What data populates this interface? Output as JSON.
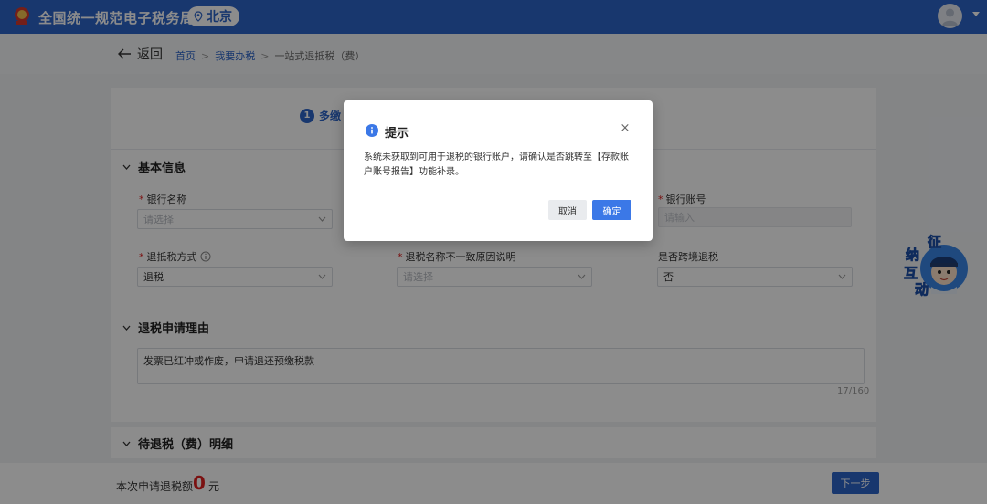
{
  "header": {
    "app_title": "全国统一规范电子税务局",
    "region": "北京",
    "brand_color": "#2c64c8"
  },
  "breadcrumb": {
    "back_label": "返回",
    "items": [
      "首页",
      "我要办税",
      "一站式退抵税（费）"
    ],
    "separator": ">"
  },
  "steps": {
    "current_number": "1",
    "current_label": "多缴"
  },
  "basic_info": {
    "section_title": "基本信息",
    "bank_name": {
      "label": "银行名称",
      "placeholder": "请选择"
    },
    "bank_account": {
      "label": "银行账号",
      "placeholder": "请输入"
    },
    "refund_method": {
      "label": "退抵税方式",
      "value": "退税"
    },
    "name_mismatch_reason": {
      "label": "退税名称不一致原因说明",
      "placeholder": "请选择"
    },
    "cross_region": {
      "label": "是否跨境退税",
      "value": "否"
    }
  },
  "reason_section": {
    "section_title": "退税申请理由",
    "text": "发票已红冲或作废，申请退还预缴税款",
    "counter": "17/160"
  },
  "pending_section": {
    "section_title": "待退税（费）明细"
  },
  "footer": {
    "amount_label": "本次申请退税额",
    "amount_value": "0",
    "amount_unit": "元",
    "next_label": "下一步"
  },
  "mascot": {
    "chars": [
      "征",
      "纳",
      "互",
      "动"
    ]
  },
  "modal": {
    "title": "提示",
    "close": "×",
    "message": "系统未获取到可用于退税的银行账户，请确认是否跳转至【存款账户账号报告】功能补录。",
    "cancel_label": "取消",
    "ok_label": "确定",
    "ok_color": "#3b78e7"
  }
}
